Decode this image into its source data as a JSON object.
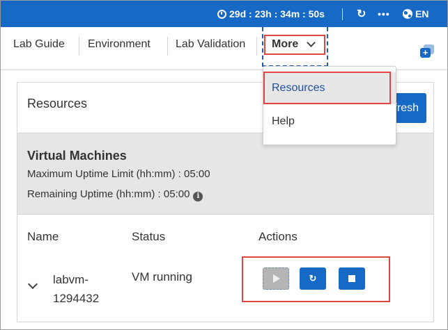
{
  "topbar": {
    "timer": "29d : 23h : 34m : 50s",
    "refresh_icon": "sync-icon",
    "more_icon": "ellipsis-icon",
    "language": "EN",
    "colors": {
      "bar": "#1769c6"
    }
  },
  "tabs": [
    {
      "label": "Lab Guide"
    },
    {
      "label": "Environment"
    },
    {
      "label": "Lab Validation"
    },
    {
      "label": "More"
    }
  ],
  "dropdown": {
    "items": [
      {
        "label": "Resources",
        "selected": true
      },
      {
        "label": "Help",
        "selected": false
      }
    ]
  },
  "resources": {
    "title": "Resources",
    "refresh_label": "Refresh"
  },
  "virtual_machines": {
    "title": "Virtual Machines",
    "max_uptime": "Maximum Uptime Limit (hh:mm) : 05:00",
    "remaining_uptime": "Remaining Uptime (hh:mm) : 05:00",
    "columns": [
      "Name",
      "Status",
      "Actions"
    ],
    "rows": [
      {
        "name": "labvm-1294432",
        "status": "VM running"
      }
    ]
  },
  "colors": {
    "accent": "#1769c6",
    "highlight_border": "#e04545",
    "panel_bg": "#e6e6e6"
  }
}
